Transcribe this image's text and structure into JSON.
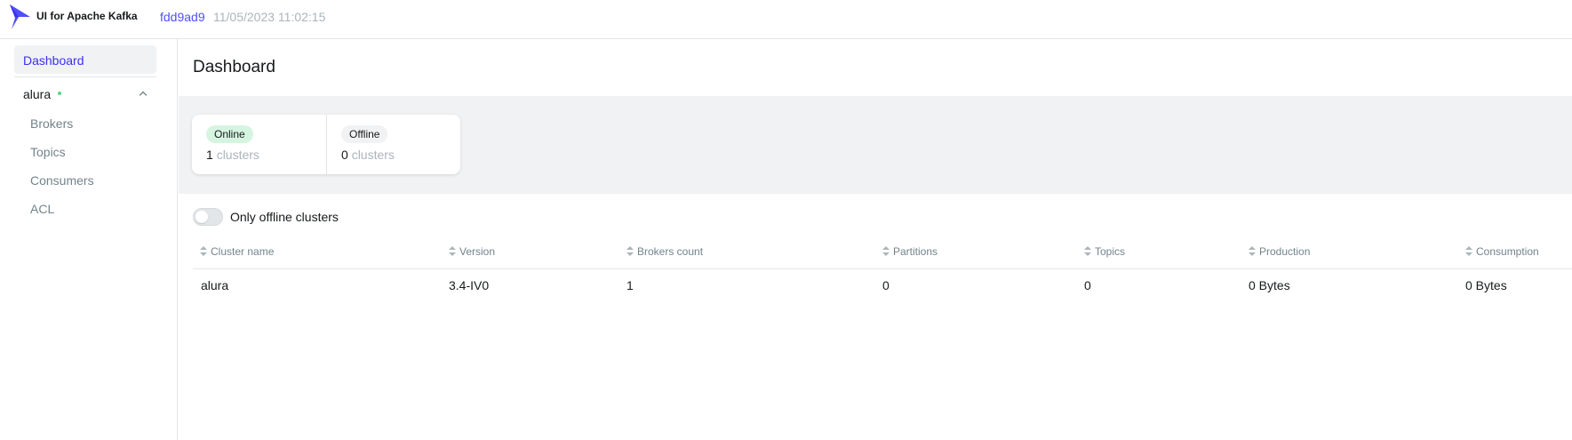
{
  "navbar": {
    "brand": "UI for Apache Kafka",
    "commit": "fdd9ad9",
    "build_date": "11/05/2023 11:02:15"
  },
  "sidebar": {
    "dashboard_label": "Dashboard",
    "cluster": {
      "name": "alura",
      "status": "online",
      "expanded": true,
      "items": [
        {
          "label": "Brokers"
        },
        {
          "label": "Topics"
        },
        {
          "label": "Consumers"
        },
        {
          "label": "ACL"
        }
      ]
    }
  },
  "main": {
    "title": "Dashboard",
    "stats": {
      "online": {
        "label": "Online",
        "count": "1",
        "unit": "clusters"
      },
      "offline": {
        "label": "Offline",
        "count": "0",
        "unit": "clusters"
      }
    },
    "toggle": {
      "label": "Only offline clusters",
      "checked": false
    },
    "table": {
      "columns": [
        "Cluster name",
        "Version",
        "Brokers count",
        "Partitions",
        "Topics",
        "Production",
        "Consumption"
      ],
      "rows": [
        [
          "alura",
          "3.4-IV0",
          "1",
          "0",
          "0",
          "0 Bytes",
          "0 Bytes"
        ]
      ]
    }
  },
  "colors": {
    "accent": "#4f4ffa",
    "nav_active": "#3b30ee",
    "online_dot": "#5cd685",
    "online_pill": "#d6f5e0",
    "band": "#f1f2f3"
  }
}
